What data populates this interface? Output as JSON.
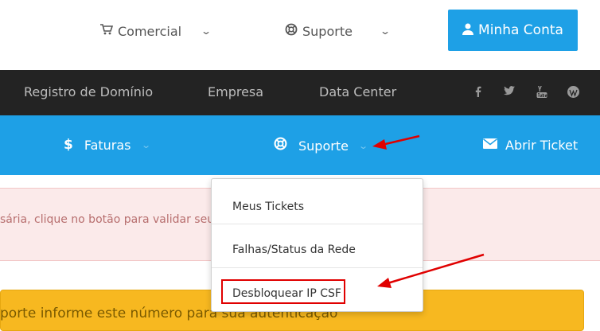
{
  "top_nav": {
    "comercial": {
      "icon": "shopping-cart-icon",
      "label": "Comercial"
    },
    "suporte": {
      "icon": "life-ring-icon",
      "label": "Suporte"
    },
    "account_button": {
      "icon": "user-icon",
      "label": "Minha Conta"
    }
  },
  "dark_nav": {
    "items": [
      "Registro de Domínio",
      "Empresa",
      "Data Center"
    ],
    "social_icons": [
      "facebook-icon",
      "twitter-icon",
      "youtube-icon",
      "wordpress-icon"
    ]
  },
  "blue_nav": {
    "faturas": {
      "icon": "dollar-icon",
      "label": "Faturas"
    },
    "suporte": {
      "icon": "life-ring-icon",
      "label": "Suporte"
    },
    "abrir_ticket": {
      "icon": "envelope-icon",
      "label": "Abrir Ticket"
    }
  },
  "dropdown": {
    "items": [
      "Meus Tickets",
      "Falhas/Status da Rede",
      "Desbloquear IP CSF"
    ]
  },
  "alerts": {
    "pink_text": "sária, clique no botão para validar seu e-m",
    "orange_text": "porte informe este número para sua autenticação"
  },
  "colors": {
    "primary_blue": "#1ea0e6",
    "dark_nav": "#232323",
    "annotation_red": "#e00000"
  }
}
